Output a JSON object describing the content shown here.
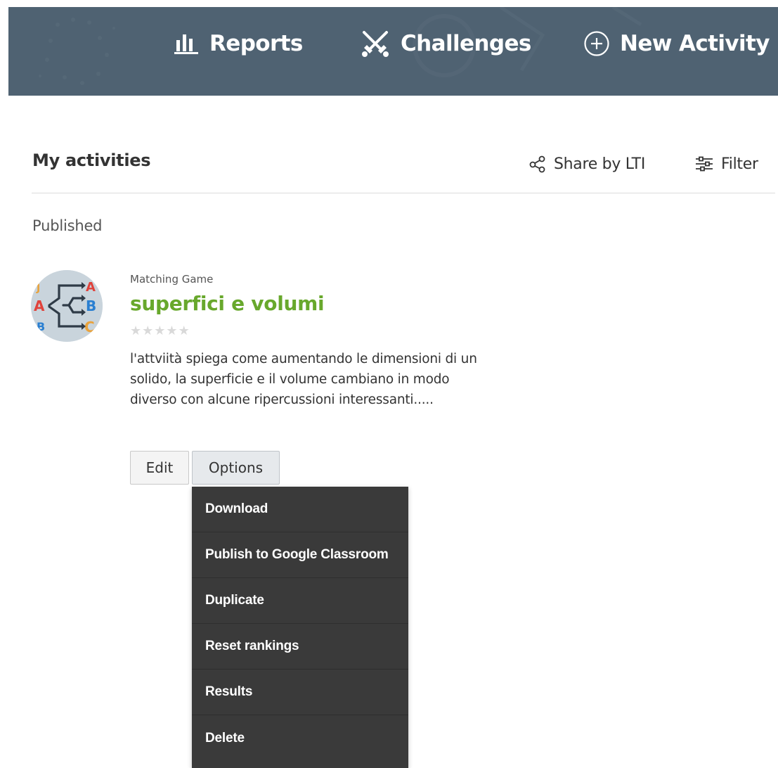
{
  "nav": {
    "items": [
      {
        "label": "Reports",
        "icon": "bar-chart-icon"
      },
      {
        "label": "Challenges",
        "icon": "crossed-swords-icon"
      },
      {
        "label": "New Activity",
        "icon": "plus-circle-icon"
      }
    ]
  },
  "header": {
    "title": "My activities",
    "share_label": "Share by LTI",
    "filter_label": "Filter"
  },
  "section": {
    "label": "Published"
  },
  "activity": {
    "type": "Matching Game",
    "title": "superfici e volumi",
    "rating_stars": 0,
    "rating_max": 5,
    "description": "l'attviità spiega come aumentando le dimensioni di un solido, la superficie e il volume cambiano in modo diverso con alcune ripercussioni interessanti.....",
    "edit_label": "Edit",
    "options_label": "Options"
  },
  "options_menu": {
    "items": [
      "Download",
      "Publish to Google Classroom",
      "Duplicate",
      "Reset rankings",
      "Results",
      "Delete"
    ]
  },
  "colors": {
    "topbar": "#4f6272",
    "title_green": "#68a82c",
    "menu_bg": "#3a3a3a"
  }
}
